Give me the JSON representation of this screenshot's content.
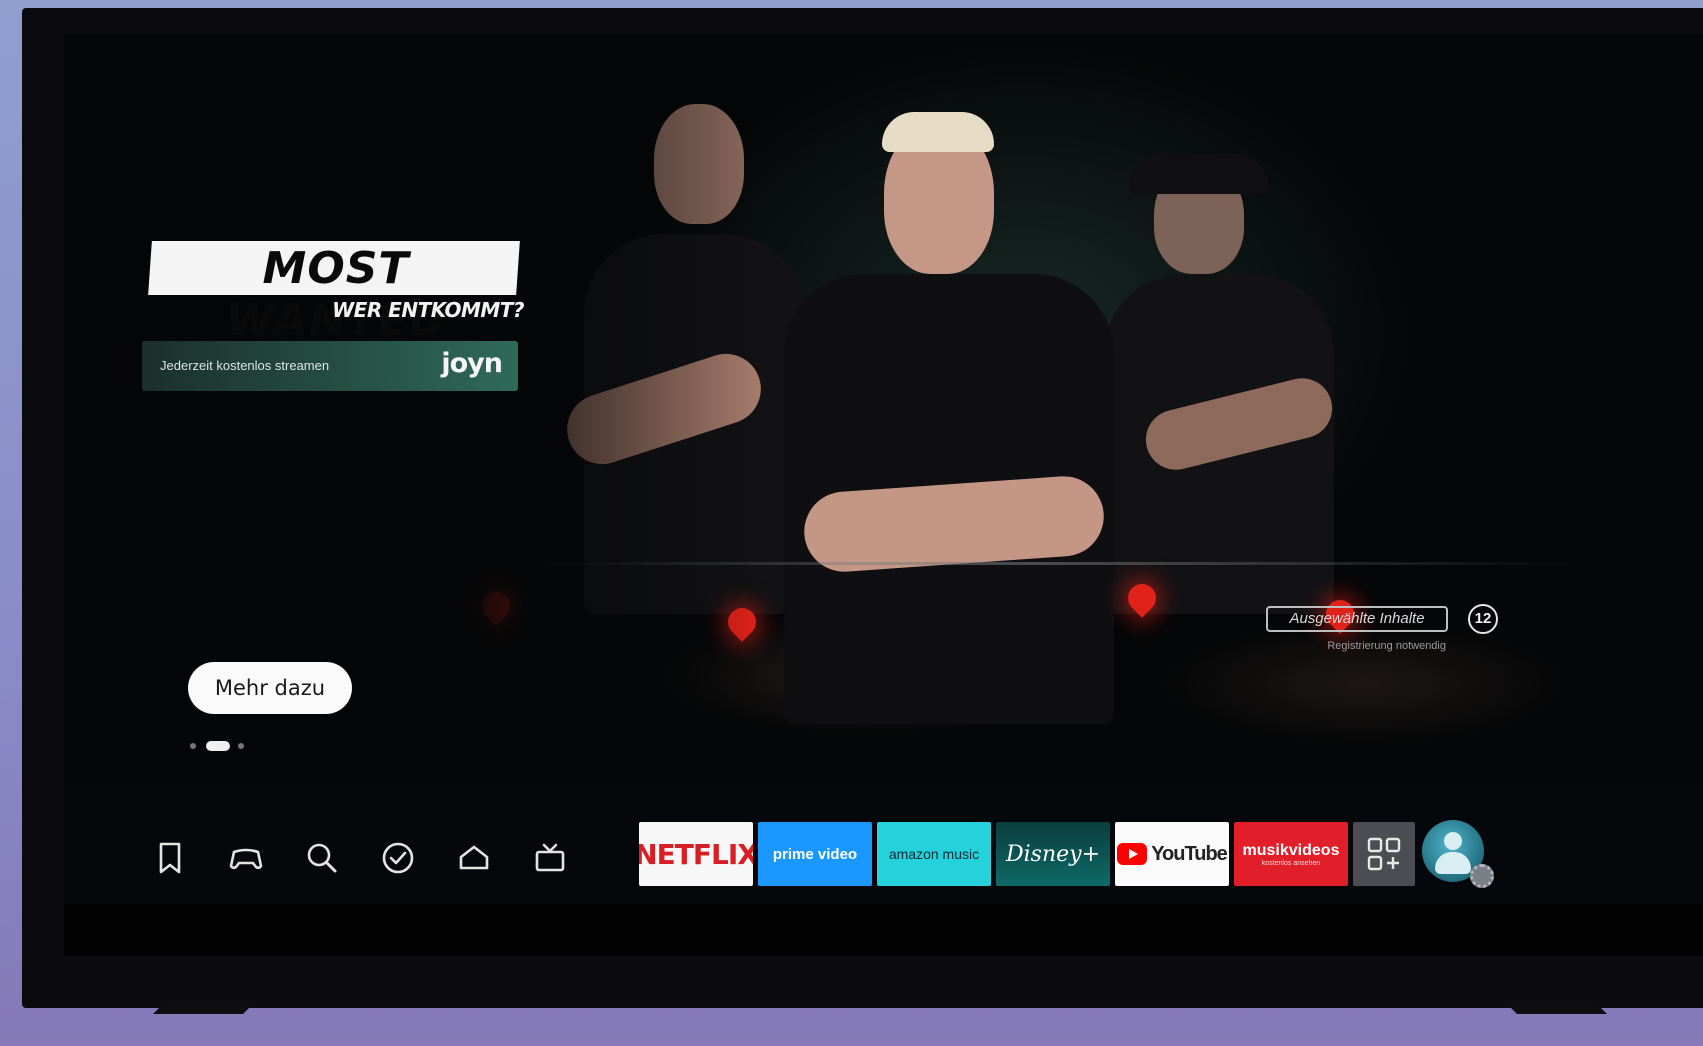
{
  "hero": {
    "title": "MOST WANTED",
    "subtitle": "WER ENTKOMMT?",
    "promo_text": "Jederzeit kostenlos streamen",
    "promo_logo": "joyn",
    "more_button": "Mehr dazu",
    "badge_label": "Ausgewählte Inhalte",
    "age_rating": "12",
    "badge_note": "Registrierung notwendig",
    "carousel": {
      "count": 3,
      "active_index": 1
    }
  },
  "nav": {
    "icons": [
      "bookmark-icon",
      "gamepad-icon",
      "search-icon",
      "check-circle-icon",
      "home-icon",
      "tv-icon"
    ],
    "apps": [
      {
        "name": "NETFLIX",
        "color": "#d81f26"
      },
      {
        "name": "prime video",
        "color": "#1a98ff"
      },
      {
        "name": "amazon music",
        "color": "#25d1da"
      },
      {
        "name": "Disney+",
        "color": "#0e6a66"
      },
      {
        "name": "YouTube",
        "color": "#ff0000"
      },
      {
        "name": "musikvideos",
        "sub": "kostenlos ansehen",
        "color": "#e01f2a"
      }
    ],
    "more_apps_icon": "apps-grid-plus-icon",
    "profile_icon": "profile-avatar-icon",
    "settings_icon": "gear-icon"
  }
}
